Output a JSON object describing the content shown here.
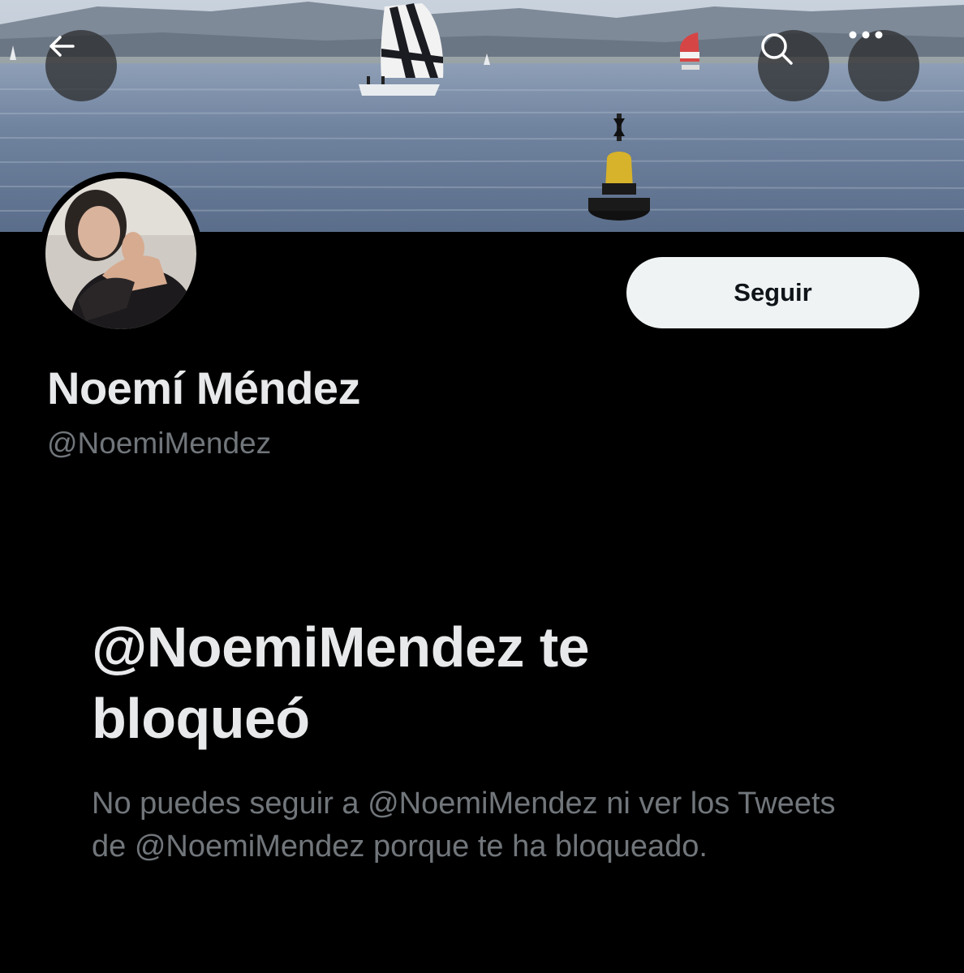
{
  "header": {
    "back_icon": "arrow-left-icon",
    "search_icon": "search-icon",
    "more_icon": "more-horizontal-icon"
  },
  "profile": {
    "display_name": "Noemí Méndez",
    "handle": "@NoemiMendez",
    "follow_label": "Seguir"
  },
  "blocked_notice": {
    "title": "@NoemiMendez te bloqueó",
    "description": "No puedes seguir a @NoemiMendez ni ver los Tweets de @NoemiMendez porque te ha bloqueado."
  },
  "colors": {
    "background": "#000000",
    "primary_text": "#e7e9ea",
    "secondary_text": "#71767b",
    "follow_button_bg": "#eff3f4"
  }
}
